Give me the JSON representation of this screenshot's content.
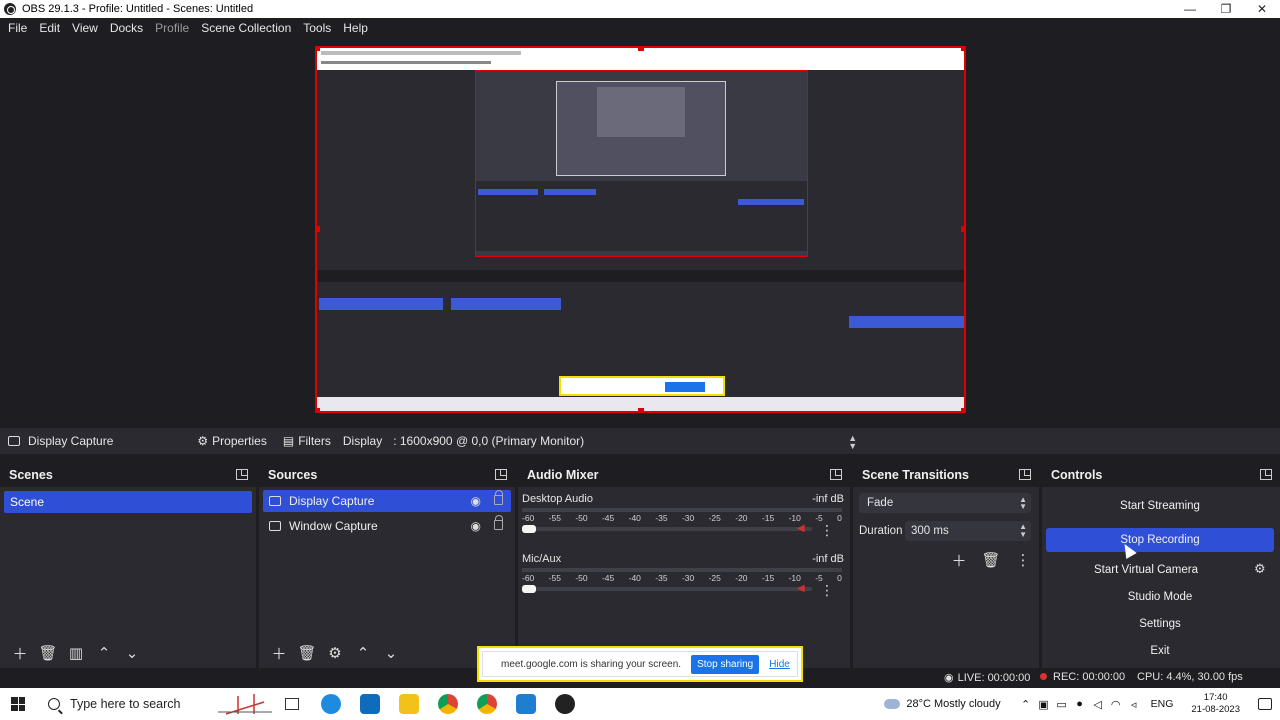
{
  "window": {
    "title": "OBS 29.1.3 - Profile: Untitled - Scenes: Untitled"
  },
  "menu": {
    "items": [
      "File",
      "Edit",
      "View",
      "Docks",
      "Profile",
      "Scene Collection",
      "Tools",
      "Help"
    ]
  },
  "source_toolbar": {
    "source_name": "Display Capture",
    "properties_label": "Properties",
    "filters_label": "Filters",
    "display_label": "Display",
    "display_value": ": 1600x900 @ 0,0 (Primary Monitor)"
  },
  "scenes": {
    "title": "Scenes",
    "items": [
      "Scene"
    ]
  },
  "sources": {
    "title": "Sources",
    "items": [
      "Display Capture",
      "Window Capture"
    ]
  },
  "audio_mixer": {
    "title": "Audio Mixer",
    "channels": [
      {
        "name": "Desktop Audio",
        "db": "-inf dB"
      },
      {
        "name": "Mic/Aux",
        "db": "-inf dB"
      }
    ],
    "ticks": [
      "-60",
      "-55",
      "-50",
      "-45",
      "-40",
      "-35",
      "-30",
      "-25",
      "-20",
      "-15",
      "-10",
      "-5",
      "0"
    ]
  },
  "transitions": {
    "title": "Scene Transitions",
    "selected": "Fade",
    "duration_label": "Duration",
    "duration_value": "300 ms"
  },
  "controls": {
    "title": "Controls",
    "start_streaming": "Start Streaming",
    "stop_recording": "Stop Recording",
    "start_virtual_camera": "Start Virtual Camera",
    "studio_mode": "Studio Mode",
    "settings": "Settings",
    "exit": "Exit"
  },
  "status": {
    "live": "LIVE: 00:00:00",
    "rec": "REC: 00:00:00",
    "cpu": "CPU: 4.4%, 30.00 fps"
  },
  "share_banner": {
    "message": "meet.google.com is sharing your screen.",
    "stop_label": "Stop sharing",
    "hide_label": "Hide"
  },
  "taskbar": {
    "search_placeholder": "Type here to search",
    "weather": "28°C  Mostly cloudy",
    "language": "ENG",
    "time": "17:40",
    "date": "21-08-2023"
  },
  "colors": {
    "accent": "#2f4fd6",
    "panel": "#2a2a30",
    "background": "#1e1e22",
    "selection_border": "#e00000"
  }
}
